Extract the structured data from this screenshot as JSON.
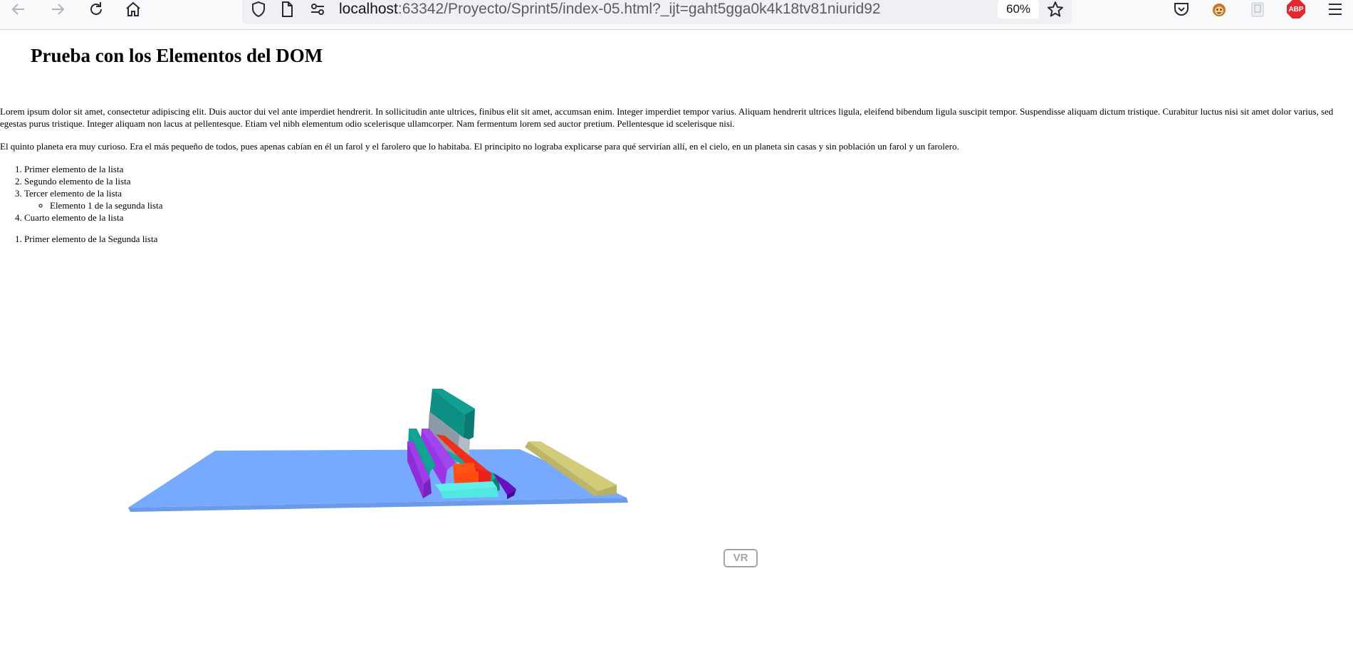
{
  "browser": {
    "url_host": "localhost",
    "url_rest": ":63342/Proyecto/Sprint5/index-05.html?_ijt=gaht5gga0k4k18tv81niurid92",
    "zoom": "60%",
    "abp_label": "ABP",
    "icons": [
      "back-arrow-icon",
      "forward-arrow-icon",
      "reload-icon",
      "home-icon",
      "shield-icon",
      "page-icon",
      "permissions-icon",
      "bookmark-star-icon",
      "pocket-icon",
      "tampermonkey-icon",
      "extension-icon",
      "adblock-plus-icon",
      "hamburger-menu-icon"
    ]
  },
  "page": {
    "title": "Prueba con los Elementos del DOM",
    "paragraph1": "Lorem ipsum dolor sit amet, consectetur adipiscing elit. Duis auctor dui vel ante imperdiet hendrerit. In sollicitudin ante ultrices, finibus elit sit amet, accumsan enim. Integer imperdiet tempor varius. Aliquam hendrerit ultrices ligula, eleifend bibendum ligula suscipit tempor. Suspendisse aliquam dictum tristique. Curabitur luctus nisi sit amet dolor varius, sed egestas purus tristique. Integer aliquam non lacus at pellentesque. Etiam vel nibh elementum odio scelerisque ullamcorper. Nam fermentum lorem sed auctor pretium. Pellentesque id scelerisque nisi.",
    "paragraph2": "El quinto planeta era muy curioso. Era el más pequeño de todos, pues apenas cabían en él un farol y el farolero que lo habitaba. El principito no lograba explicarse para qué servirían allí, en el cielo, en un planeta sin casas y sin población un farol y un farolero.",
    "list1": {
      "item1": "Primer elemento de la lista",
      "item2": "Segundo elemento de la lista",
      "item3": "Tercer elemento de la lista",
      "sub_item1": "Elemento 1 de la segunda lista",
      "item4": "Cuarto elemento de la lista"
    },
    "list2": {
      "item1": "Primer elemento de la Segunda lista"
    }
  },
  "scene": {
    "vr_button": "VR",
    "colors": {
      "ground": "#77aaff",
      "teal": "#0e9e92",
      "gray": "#8c9aa8",
      "purple": "#9b35e8",
      "orange_red": "#ff4a14",
      "red": "#e8221a",
      "cyan": "#52e8e2",
      "indigo": "#5a0aa8",
      "khaki": "#d2cc7a"
    }
  }
}
